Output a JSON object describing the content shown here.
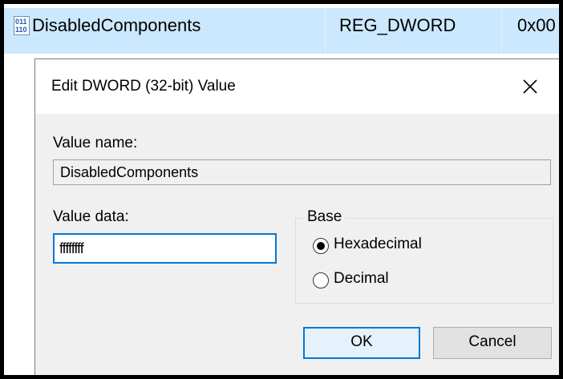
{
  "registry_row": {
    "name": "DisabledComponents",
    "type": "REG_DWORD",
    "data": "0x00",
    "icon": "reg-binary-icon"
  },
  "dialog": {
    "title": "Edit DWORD (32-bit) Value",
    "close_icon": "close-icon",
    "value_name_label": "Value name:",
    "value_name": "DisabledComponents",
    "value_data_label": "Value data:",
    "value_data": "ffffffff",
    "base": {
      "legend": "Base",
      "options": [
        "Hexadecimal",
        "Decimal"
      ],
      "selected": "Hexadecimal"
    },
    "ok_label": "OK",
    "cancel_label": "Cancel"
  },
  "colors": {
    "selection": "#cce8ff",
    "accent": "#0078d7",
    "dialog_bg": "#f0f0f0"
  }
}
